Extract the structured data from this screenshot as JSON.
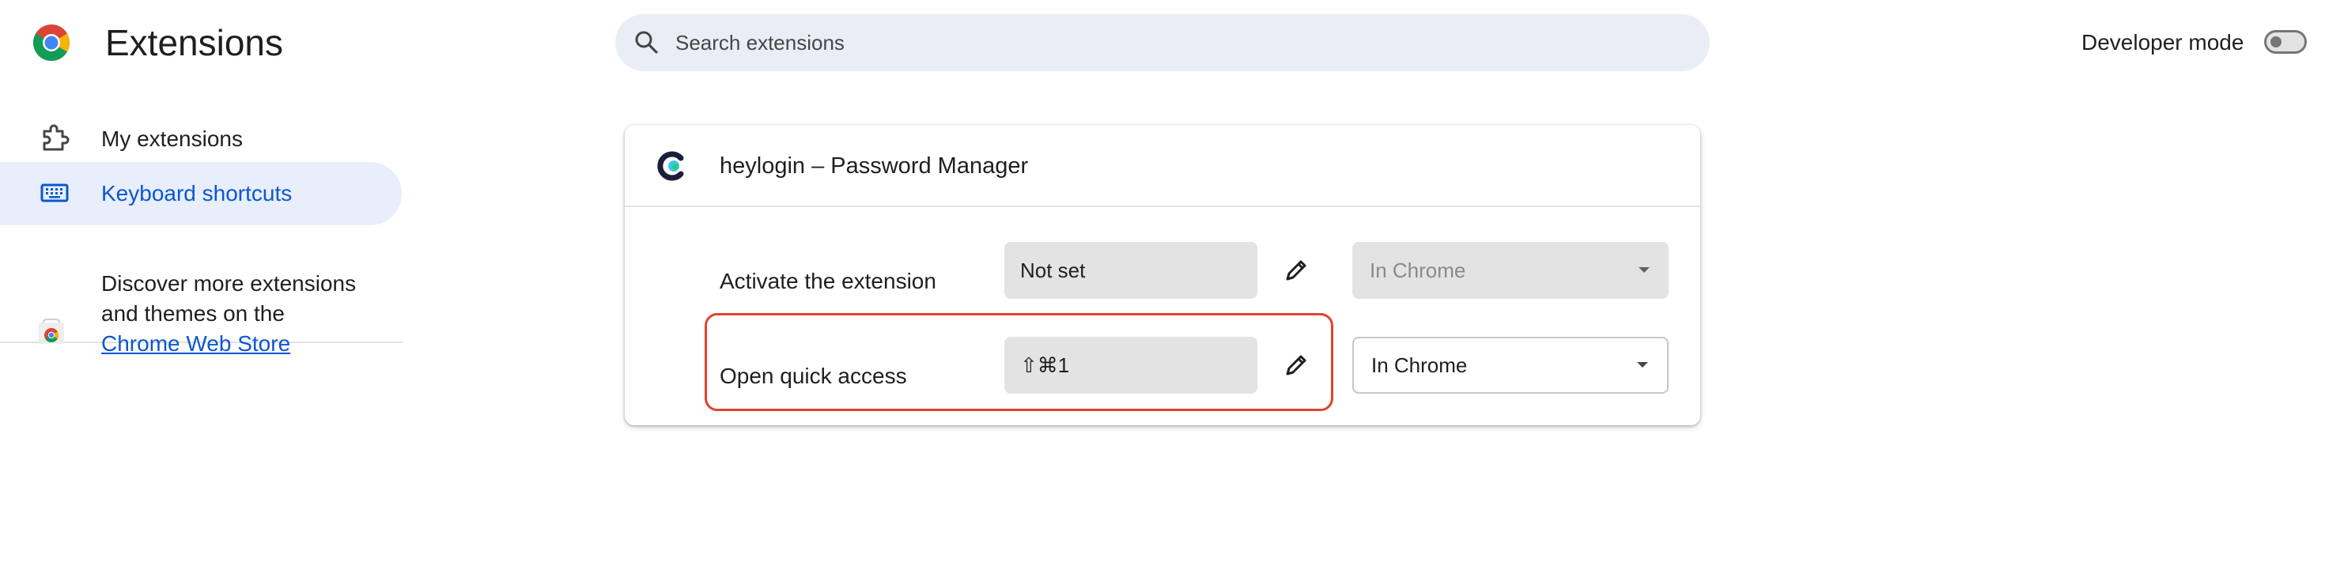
{
  "header": {
    "title": "Extensions",
    "logo_icon": "chrome-logo-icon",
    "search": {
      "placeholder": "Search extensions",
      "value": "",
      "icon": "search-icon"
    },
    "developer_mode": {
      "label": "Developer mode",
      "enabled": false
    }
  },
  "sidebar": {
    "items": [
      {
        "label": "My extensions",
        "icon": "puzzle-icon",
        "active": false
      },
      {
        "label": "Keyboard shortcuts",
        "icon": "keyboard-icon",
        "active": true
      }
    ],
    "discover": {
      "text_before": "Discover more extensions and themes on the ",
      "link_text": "Chrome Web Store",
      "icon": "chrome-web-store-icon"
    }
  },
  "card": {
    "extension_name": "heylogin – Password Manager",
    "extension_icon": "heylogin-icon",
    "shortcuts": [
      {
        "label": "Activate the extension",
        "key": "Not set",
        "scope": "In Chrome",
        "scope_enabled": false,
        "edit_icon": "pencil-icon"
      },
      {
        "label": "Open quick access",
        "key": "⇧⌘1",
        "scope": "In Chrome",
        "scope_enabled": true,
        "edit_icon": "pencil-icon",
        "highlighted": true
      }
    ]
  },
  "colors": {
    "accent": "#0b57d0",
    "active_nav_bg": "#e8eefb",
    "search_bg": "#e9eef6",
    "field_bg": "#e3e3e3",
    "highlight": "#e0442e"
  }
}
